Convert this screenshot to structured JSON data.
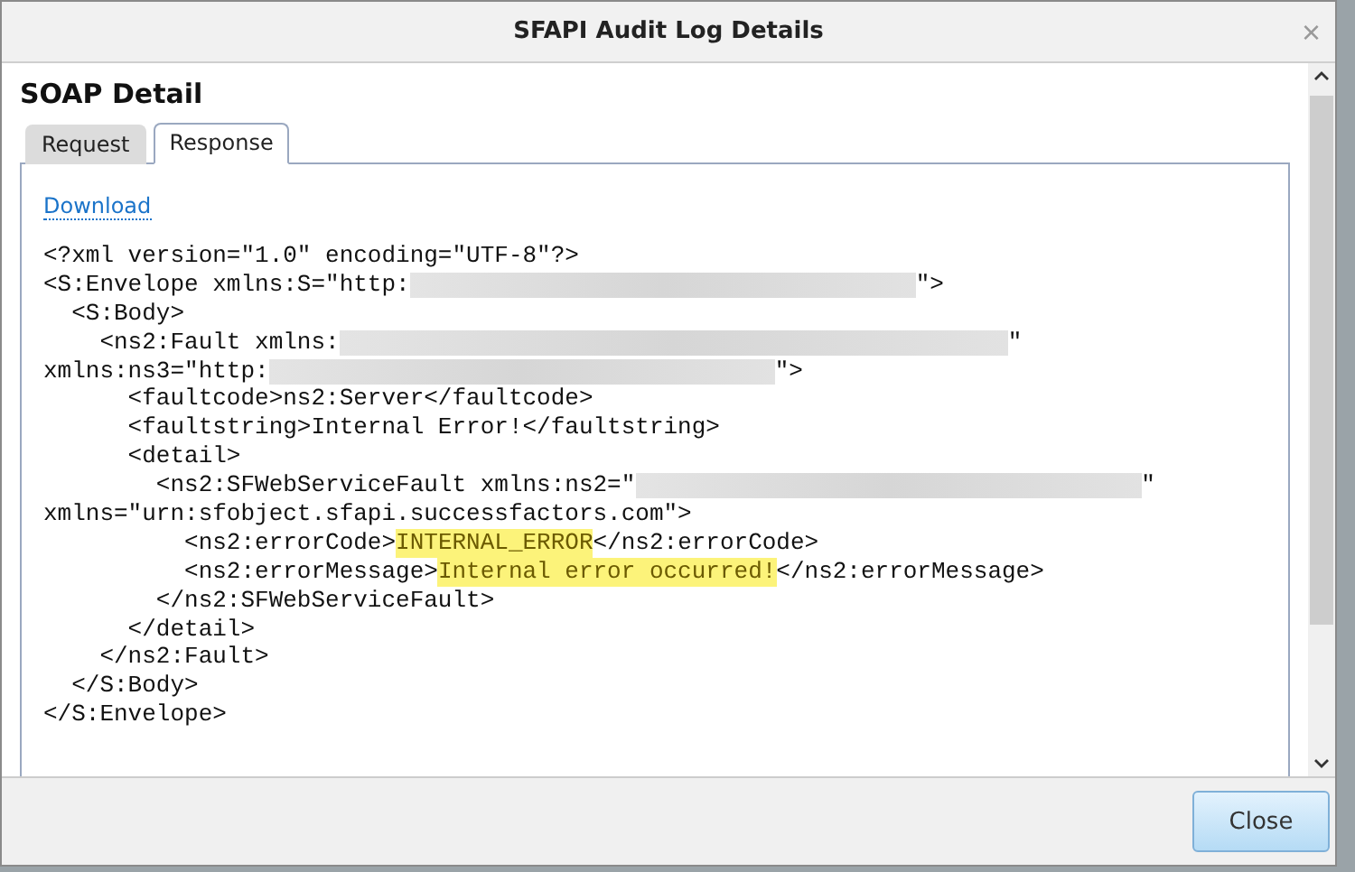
{
  "window": {
    "title": "SFAPI Audit Log Details",
    "close": "×"
  },
  "section_title": "SOAP Detail",
  "tabs": [
    {
      "label": "Request",
      "selected": false
    },
    {
      "label": "Response",
      "selected": true
    }
  ],
  "download_link": "Download",
  "code_lines": [
    [
      {
        "kind": "text",
        "text": "<?xml version=\"1.0\" encoding=\"UTF-8\"?>"
      }
    ],
    [
      {
        "kind": "text",
        "text": "<S:Envelope xmlns:S=\"http:"
      },
      {
        "kind": "redacted"
      },
      {
        "kind": "text",
        "text": "\">"
      }
    ],
    [
      {
        "kind": "text",
        "text": "  <S:Body>"
      }
    ],
    [
      {
        "kind": "text",
        "text": "    <ns2:Fault xmlns:"
      },
      {
        "kind": "longredacted"
      },
      {
        "kind": "text",
        "text": "\""
      }
    ],
    [
      {
        "kind": "text",
        "text": "xmlns:ns3=\"http:"
      },
      {
        "kind": "redacted"
      },
      {
        "kind": "text",
        "text": "\">"
      }
    ],
    [
      {
        "kind": "text",
        "text": "      <faultcode>ns2:Server</faultcode>"
      }
    ],
    [
      {
        "kind": "text",
        "text": "      <faultstring>Internal Error!</faultstring>"
      }
    ],
    [
      {
        "kind": "text",
        "text": "      <detail>"
      }
    ],
    [
      {
        "kind": "text",
        "text": "        <ns2:SFWebServiceFault xmlns:ns2=\""
      },
      {
        "kind": "redacted"
      },
      {
        "kind": "text",
        "text": "\""
      }
    ],
    [
      {
        "kind": "text",
        "text": "xmlns=\"urn:sfobject.sfapi.successfactors.com\">"
      }
    ],
    [
      {
        "kind": "text",
        "text": "          <ns2:errorCode>"
      },
      {
        "kind": "highlight",
        "text": "INTERNAL_ERROR"
      },
      {
        "kind": "text",
        "text": "</ns2:errorCode>"
      }
    ],
    [
      {
        "kind": "text",
        "text": "          <ns2:errorMessage>"
      },
      {
        "kind": "highlight",
        "text": "Internal error occurred!"
      },
      {
        "kind": "text",
        "text": "</ns2:errorMessage>"
      }
    ],
    [
      {
        "kind": "text",
        "text": "        </ns2:SFWebServiceFault>"
      }
    ],
    [
      {
        "kind": "text",
        "text": "      </detail>"
      }
    ],
    [
      {
        "kind": "text",
        "text": "    </ns2:Fault>"
      }
    ],
    [
      {
        "kind": "text",
        "text": "  </S:Body>"
      }
    ],
    [
      {
        "kind": "text",
        "text": "</S:Envelope>"
      }
    ]
  ],
  "buttons": [
    "Close"
  ]
}
